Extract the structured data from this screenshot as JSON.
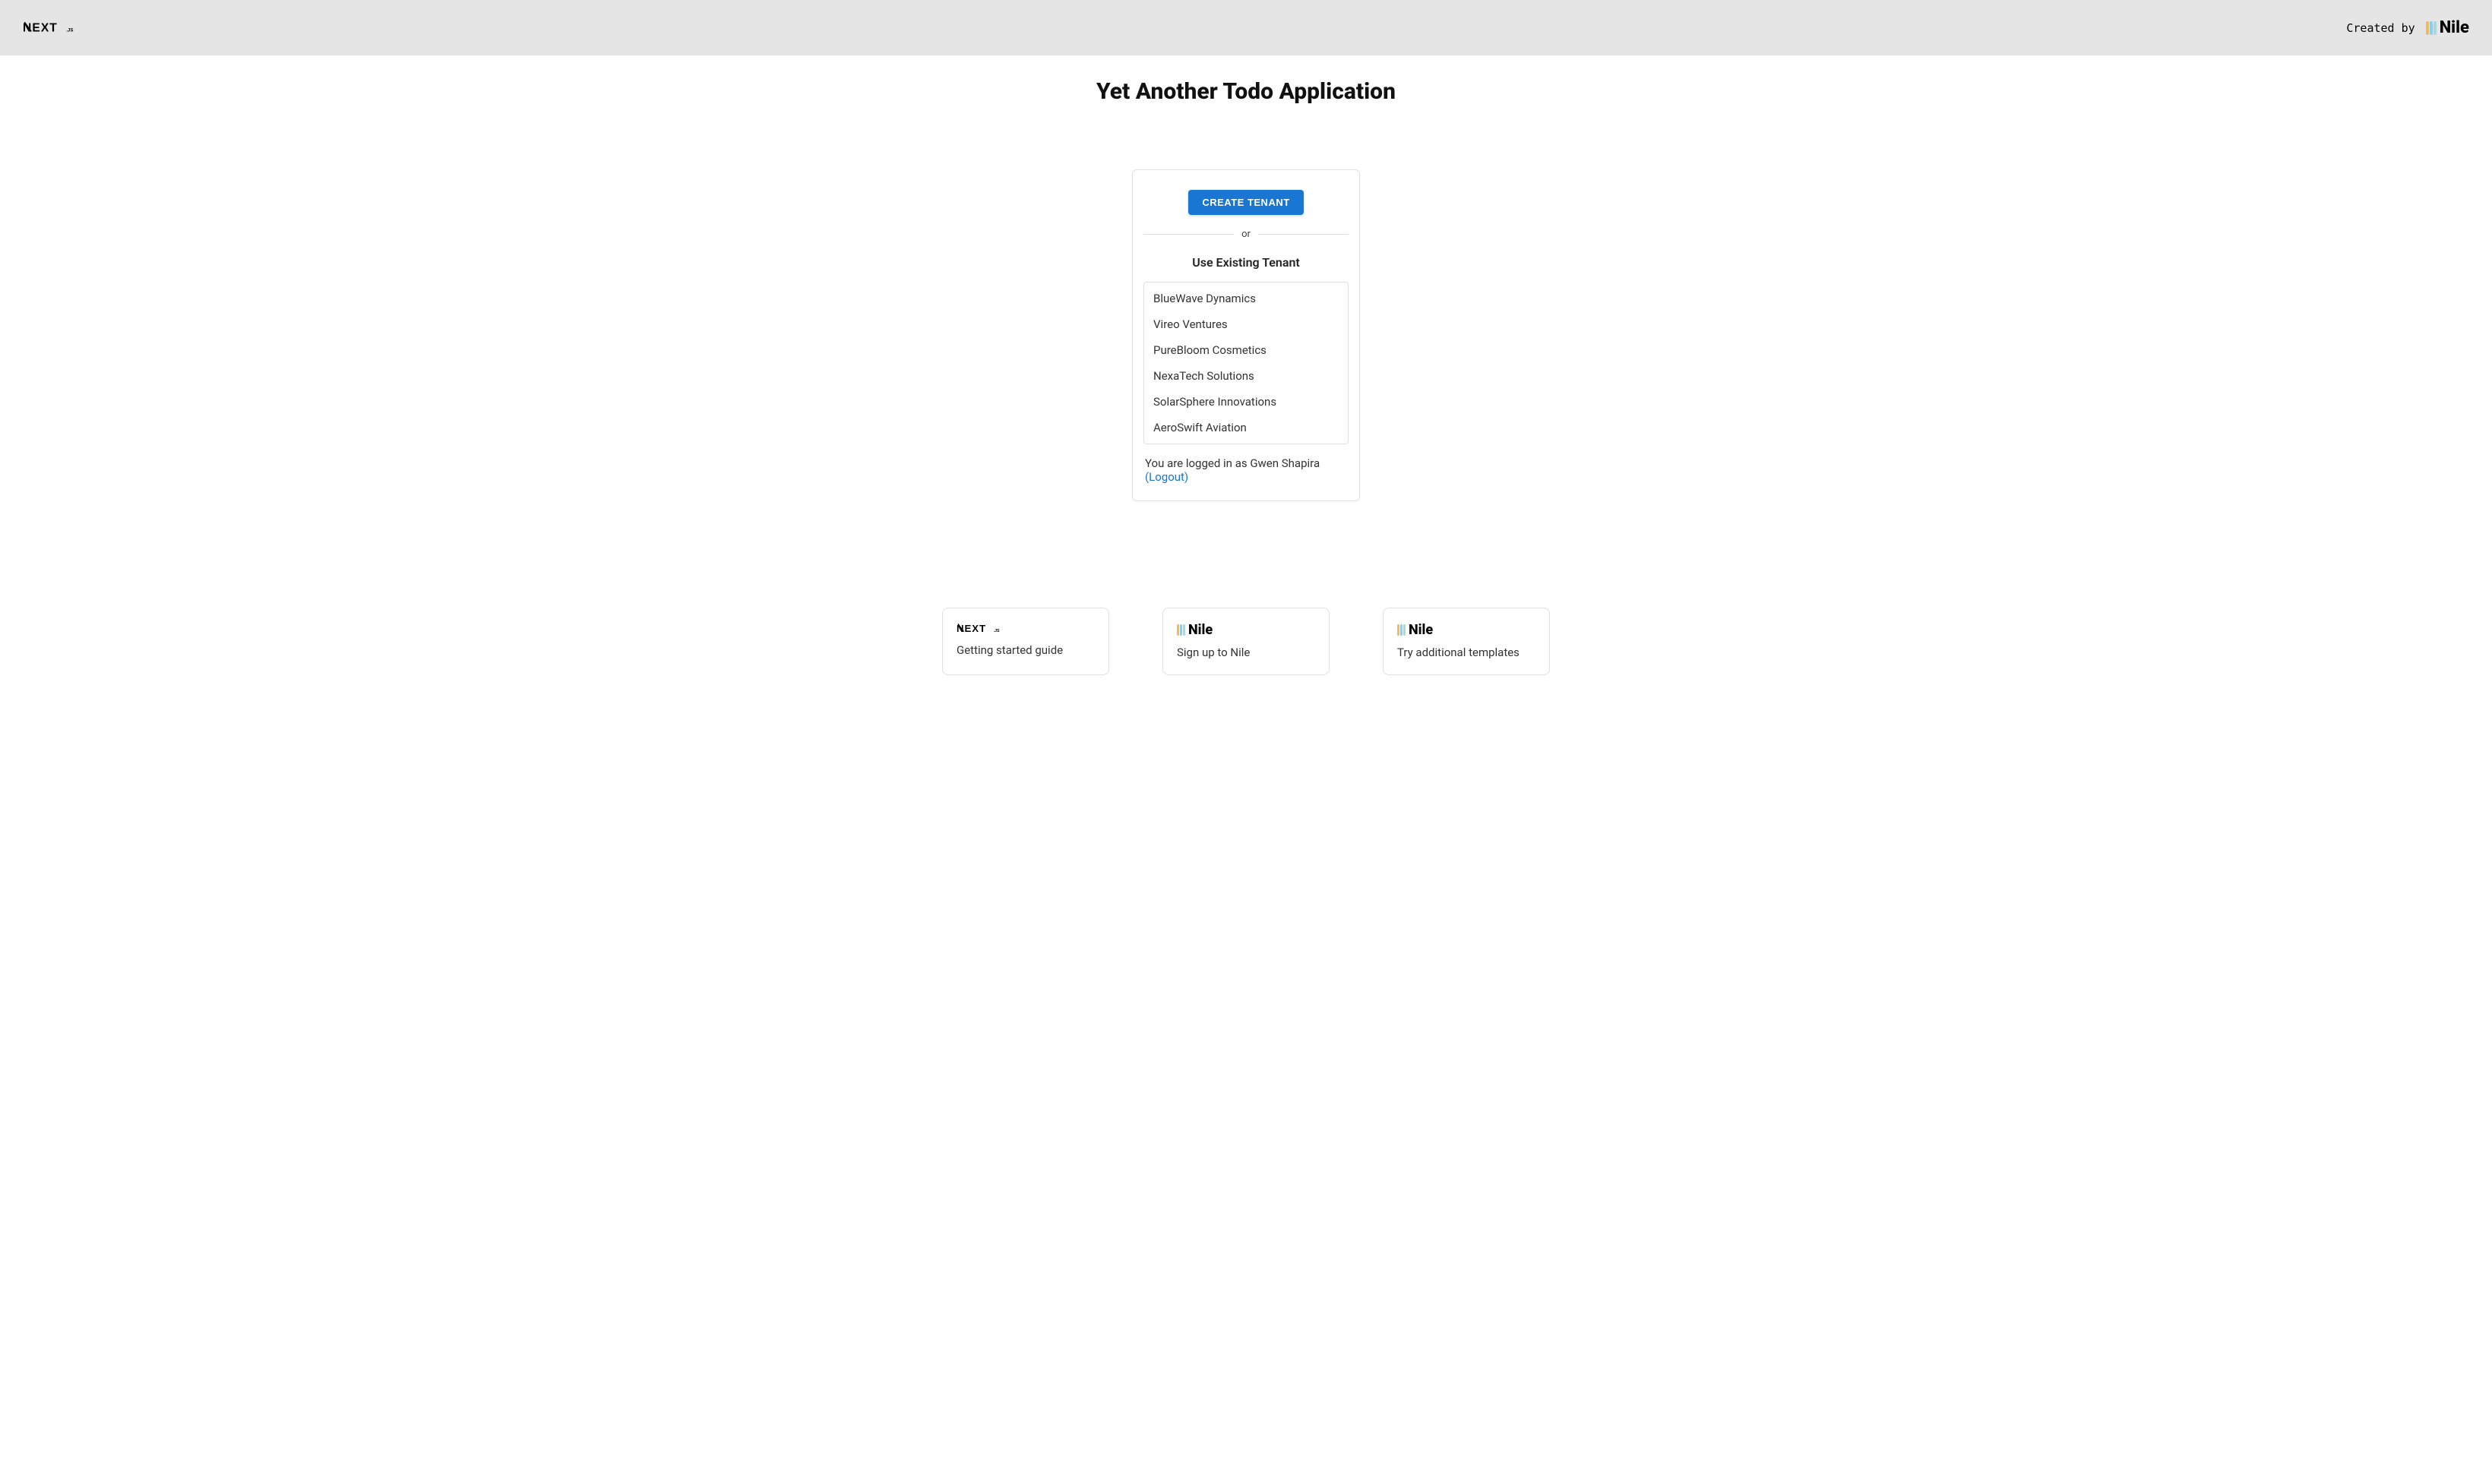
{
  "header": {
    "created_by": "Created by",
    "nile_brand": "Nile"
  },
  "page": {
    "title": "Yet Another Todo Application"
  },
  "card": {
    "create_button": "CREATE TENANT",
    "divider_text": "or",
    "existing_title": "Use Existing Tenant",
    "tenants": [
      "BlueWave Dynamics",
      "Vireo Ventures",
      "PureBloom Cosmetics",
      "NexaTech Solutions",
      "SolarSphere Innovations",
      "AeroSwift Aviation"
    ],
    "login_status_prefix": "You are logged in as ",
    "user_name": "Gwen Shapira",
    "logout_text": "(Logout)"
  },
  "footer_cards": [
    {
      "logo": "nextjs",
      "text": "Getting started guide"
    },
    {
      "logo": "nile",
      "text": "Sign up to Nile"
    },
    {
      "logo": "nile",
      "text": "Try additional templates"
    }
  ]
}
